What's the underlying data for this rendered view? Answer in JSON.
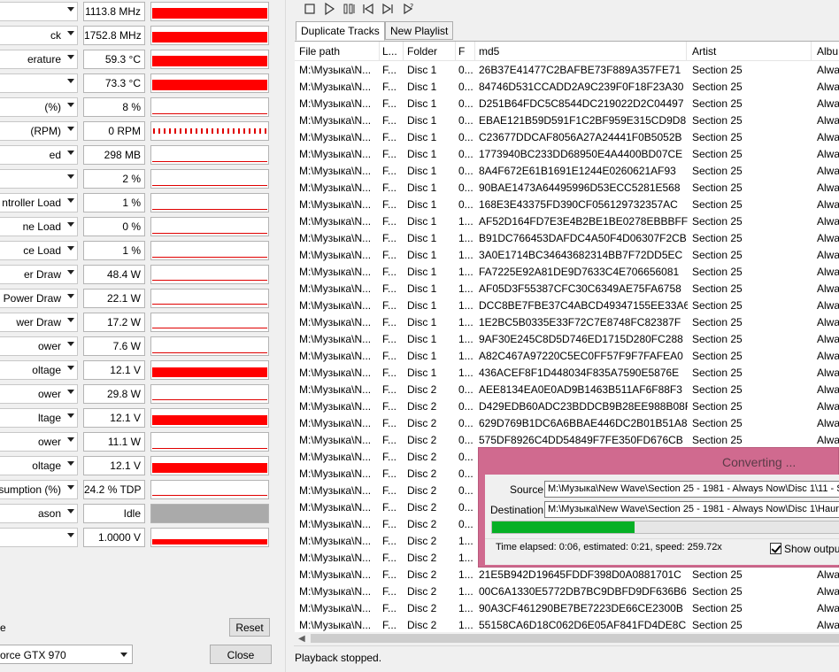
{
  "sensor_panel": {
    "rows": [
      {
        "label": "",
        "value": "1113.8 MHz",
        "graph": "fill",
        "level": 0.6
      },
      {
        "label": "ck",
        "value": "1752.8 MHz",
        "graph": "fill",
        "level": 0.6
      },
      {
        "label": "erature",
        "value": "59.3 °C",
        "graph": "fill",
        "level": 0.6
      },
      {
        "label": "",
        "value": "73.3 °C",
        "graph": "fill",
        "level": 0.6
      },
      {
        "label": "(%)",
        "value": "8 %",
        "graph": "line",
        "level": 0.08
      },
      {
        "label": "(RPM)",
        "value": "0 RPM",
        "graph": "dashed",
        "level": 0
      },
      {
        "label": "ed",
        "value": "298 MB",
        "graph": "line",
        "level": 0.07
      },
      {
        "label": "",
        "value": "2 %",
        "graph": "line",
        "level": 0.02
      },
      {
        "label": "ntroller Load",
        "value": "1 %",
        "graph": "line",
        "level": 0.01
      },
      {
        "label": "ne Load",
        "value": "0 %",
        "graph": "line",
        "level": 0
      },
      {
        "label": "ce Load",
        "value": "1 %",
        "graph": "line",
        "level": 0.01
      },
      {
        "label": "er Draw",
        "value": "48.4 W",
        "graph": "line",
        "level": 0.15
      },
      {
        "label": "Power Draw",
        "value": "22.1 W",
        "graph": "line",
        "level": 0.1
      },
      {
        "label": "wer Draw",
        "value": "17.2 W",
        "graph": "line",
        "level": 0.1
      },
      {
        "label": "ower",
        "value": "7.6 W",
        "graph": "line",
        "level": 0.05
      },
      {
        "label": "oltage",
        "value": "12.1 V",
        "graph": "fill",
        "level": 0.55
      },
      {
        "label": "ower",
        "value": "29.8 W",
        "graph": "line",
        "level": 0.15
      },
      {
        "label": "ltage",
        "value": "12.1 V",
        "graph": "fill",
        "level": 0.55
      },
      {
        "label": "ower",
        "value": "11.1 W",
        "graph": "line",
        "level": 0.05
      },
      {
        "label": "oltage",
        "value": "12.1 V",
        "graph": "fill",
        "level": 0.55
      },
      {
        "label": "sumption (%)",
        "value": "24.2 % TDP",
        "graph": "line",
        "level": 0.2
      },
      {
        "label": "ason",
        "value": "Idle",
        "graph": "grey",
        "level": 1
      },
      {
        "label": "",
        "value": "1.0000 V",
        "graph": "fill",
        "level": 0.3
      }
    ],
    "footer_label": "e",
    "reset_label": "Reset",
    "gpu_select_value": "orce GTX 970",
    "close_label": "Close"
  },
  "player": {
    "tabs": [
      {
        "label": "Duplicate Tracks",
        "active": true
      },
      {
        "label": "New Playlist",
        "active": false
      }
    ],
    "columns": [
      "File path",
      "L...",
      "Folder",
      "F",
      "md5",
      "Artist",
      "Albu"
    ],
    "rows": [
      [
        "M:\\Музыка\\N...",
        "F...",
        "Disc 1",
        "0...",
        "26B37E41477C2BAFBE73F889A357FE71",
        "Section 25",
        "Alwa"
      ],
      [
        "M:\\Музыка\\N...",
        "F...",
        "Disc 1",
        "0...",
        "84746D531CCADD2A9C239F0F18F23A30",
        "Section 25",
        "Alwa"
      ],
      [
        "M:\\Музыка\\N...",
        "F...",
        "Disc 1",
        "0...",
        "D251B64FDC5C8544DC219022D2C04497",
        "Section 25",
        "Alwa"
      ],
      [
        "M:\\Музыка\\N...",
        "F...",
        "Disc 1",
        "0...",
        "EBAE121B59D591F1C2BF959E315CD9D8",
        "Section 25",
        "Alwa"
      ],
      [
        "M:\\Музыка\\N...",
        "F...",
        "Disc 1",
        "0...",
        "C23677DDCAF8056A27A24441F0B5052B",
        "Section 25",
        "Alwa"
      ],
      [
        "M:\\Музыка\\N...",
        "F...",
        "Disc 1",
        "0...",
        "1773940BC233DD68950E4A4400BD07CE",
        "Section 25",
        "Alwa"
      ],
      [
        "M:\\Музыка\\N...",
        "F...",
        "Disc 1",
        "0...",
        "8A4F672E61B1691E1244E0260621AF93",
        "Section 25",
        "Alwa"
      ],
      [
        "M:\\Музыка\\N...",
        "F...",
        "Disc 1",
        "0...",
        "90BAE1473A64495996D53ECC5281E568",
        "Section 25",
        "Alwa"
      ],
      [
        "M:\\Музыка\\N...",
        "F...",
        "Disc 1",
        "0...",
        "168E3E43375FD390CF056129732357AC",
        "Section 25",
        "Alwa"
      ],
      [
        "M:\\Музыка\\N...",
        "F...",
        "Disc 1",
        "1...",
        "AF52D164FD7E3E4B2BE1BE0278EBBBFF",
        "Section 25",
        "Alwa"
      ],
      [
        "M:\\Музыка\\N...",
        "F...",
        "Disc 1",
        "1...",
        "B91DC766453DAFDC4A50F4D06307F2CB",
        "Section 25",
        "Alwa"
      ],
      [
        "M:\\Музыка\\N...",
        "F...",
        "Disc 1",
        "1...",
        "3A0E1714BC34643682314BB7F72DD5EC",
        "Section 25",
        "Alwa"
      ],
      [
        "M:\\Музыка\\N...",
        "F...",
        "Disc 1",
        "1...",
        "FA7225E92A81DE9D7633C4E706656081",
        "Section 25",
        "Alwa"
      ],
      [
        "M:\\Музыка\\N...",
        "F...",
        "Disc 1",
        "1...",
        "AF05D3F55387CFC30C6349AE75FA6758",
        "Section 25",
        "Alwa"
      ],
      [
        "M:\\Музыка\\N...",
        "F...",
        "Disc 1",
        "1...",
        "DCC8BE7FBE37C4ABCD49347155EE33A6",
        "Section 25",
        "Alwa"
      ],
      [
        "M:\\Музыка\\N...",
        "F...",
        "Disc 1",
        "1...",
        "1E2BC5B0335E33F72C7E8748FC82387F",
        "Section 25",
        "Alwa"
      ],
      [
        "M:\\Музыка\\N...",
        "F...",
        "Disc 1",
        "1...",
        "9AF30E245C8D5D746ED1715D280FC288",
        "Section 25",
        "Alwa"
      ],
      [
        "M:\\Музыка\\N...",
        "F...",
        "Disc 1",
        "1...",
        "A82C467A97220C5EC0FF57F9F7FAFEA0",
        "Section 25",
        "Alwa"
      ],
      [
        "M:\\Музыка\\N...",
        "F...",
        "Disc 1",
        "1...",
        "436ACEF8F1D448034F835A7590E5876E",
        "Section 25",
        "Alwa"
      ],
      [
        "M:\\Музыка\\N...",
        "F...",
        "Disc 2",
        "0...",
        "AEE8134EA0E0AD9B1463B511AF6F88F3",
        "Section 25",
        "Alwa"
      ],
      [
        "M:\\Музыка\\N...",
        "F...",
        "Disc 2",
        "0...",
        "D429EDB60ADC23BDDCB9B28EE988B08F",
        "Section 25",
        "Alwa"
      ],
      [
        "M:\\Музыка\\N...",
        "F...",
        "Disc 2",
        "0...",
        "629D769B1DC6A6BBAE446DC2B01B51A8",
        "Section 25",
        "Alwa"
      ],
      [
        "M:\\Музыка\\N...",
        "F...",
        "Disc 2",
        "0...",
        "575DF8926C4DD54849F7FE350FD676CB",
        "Section 25",
        "Alwa"
      ],
      [
        "M:\\Музыка\\N...",
        "F...",
        "Disc 2",
        "0...",
        "",
        "",
        ""
      ],
      [
        "M:\\Музыка\\N...",
        "F...",
        "Disc 2",
        "0...",
        "",
        "",
        ""
      ],
      [
        "M:\\Музыка\\N...",
        "F...",
        "Disc 2",
        "0...",
        "",
        "",
        ""
      ],
      [
        "M:\\Музыка\\N...",
        "F...",
        "Disc 2",
        "0...",
        "",
        "",
        ""
      ],
      [
        "M:\\Музыка\\N...",
        "F...",
        "Disc 2",
        "0...",
        "",
        "",
        ""
      ],
      [
        "M:\\Музыка\\N...",
        "F...",
        "Disc 2",
        "1...",
        "",
        "",
        ""
      ],
      [
        "M:\\Музыка\\N...",
        "F...",
        "Disc 2",
        "1...",
        "",
        "",
        ""
      ],
      [
        "M:\\Музыка\\N...",
        "F...",
        "Disc 2",
        "1...",
        "21E5B942D19645FDDF398D0A0881701C",
        "Section 25",
        "Alwa"
      ],
      [
        "M:\\Музыка\\N...",
        "F...",
        "Disc 2",
        "1...",
        "00C6A1330E5772DB7BC9DBFD9DF636B6",
        "Section 25",
        "Alwa"
      ],
      [
        "M:\\Музыка\\N...",
        "F...",
        "Disc 2",
        "1...",
        "90A3CF461290BE7BE7223DE66CE2300B",
        "Section 25",
        "Alwa"
      ],
      [
        "M:\\Музыка\\N...",
        "F...",
        "Disc 2",
        "1...",
        "55158CA6D18C062D6E05AF841FD4DE8C",
        "Section 25",
        "Alwa"
      ]
    ],
    "status": "Playback stopped."
  },
  "dialog": {
    "title": "Converting ...",
    "source_label": "Source:",
    "source_value": "M:\\Музыка\\New Wave\\Section 25 - 1981 - Always Now\\Disc 1\\11 - S",
    "destination_label": "Destination:",
    "destination_value": "M:\\Музыка\\New Wave\\Section 25 - 1981 - Always Now\\Disc 1\\Haun",
    "progress": 0.41,
    "time_text": "Time elapsed: 0:06, estimated: 0:21, speed: 259.72x",
    "show_output_label": "Show output",
    "show_output_checked": true
  },
  "colors": {
    "graph_red": "#ff0000",
    "progress_green": "#06b025",
    "dialog_frame": "#d06a8f"
  },
  "icons": {
    "toolbar": [
      "stop-icon",
      "play-icon",
      "pause-icon",
      "previous-icon",
      "next-icon",
      "random-icon"
    ]
  }
}
